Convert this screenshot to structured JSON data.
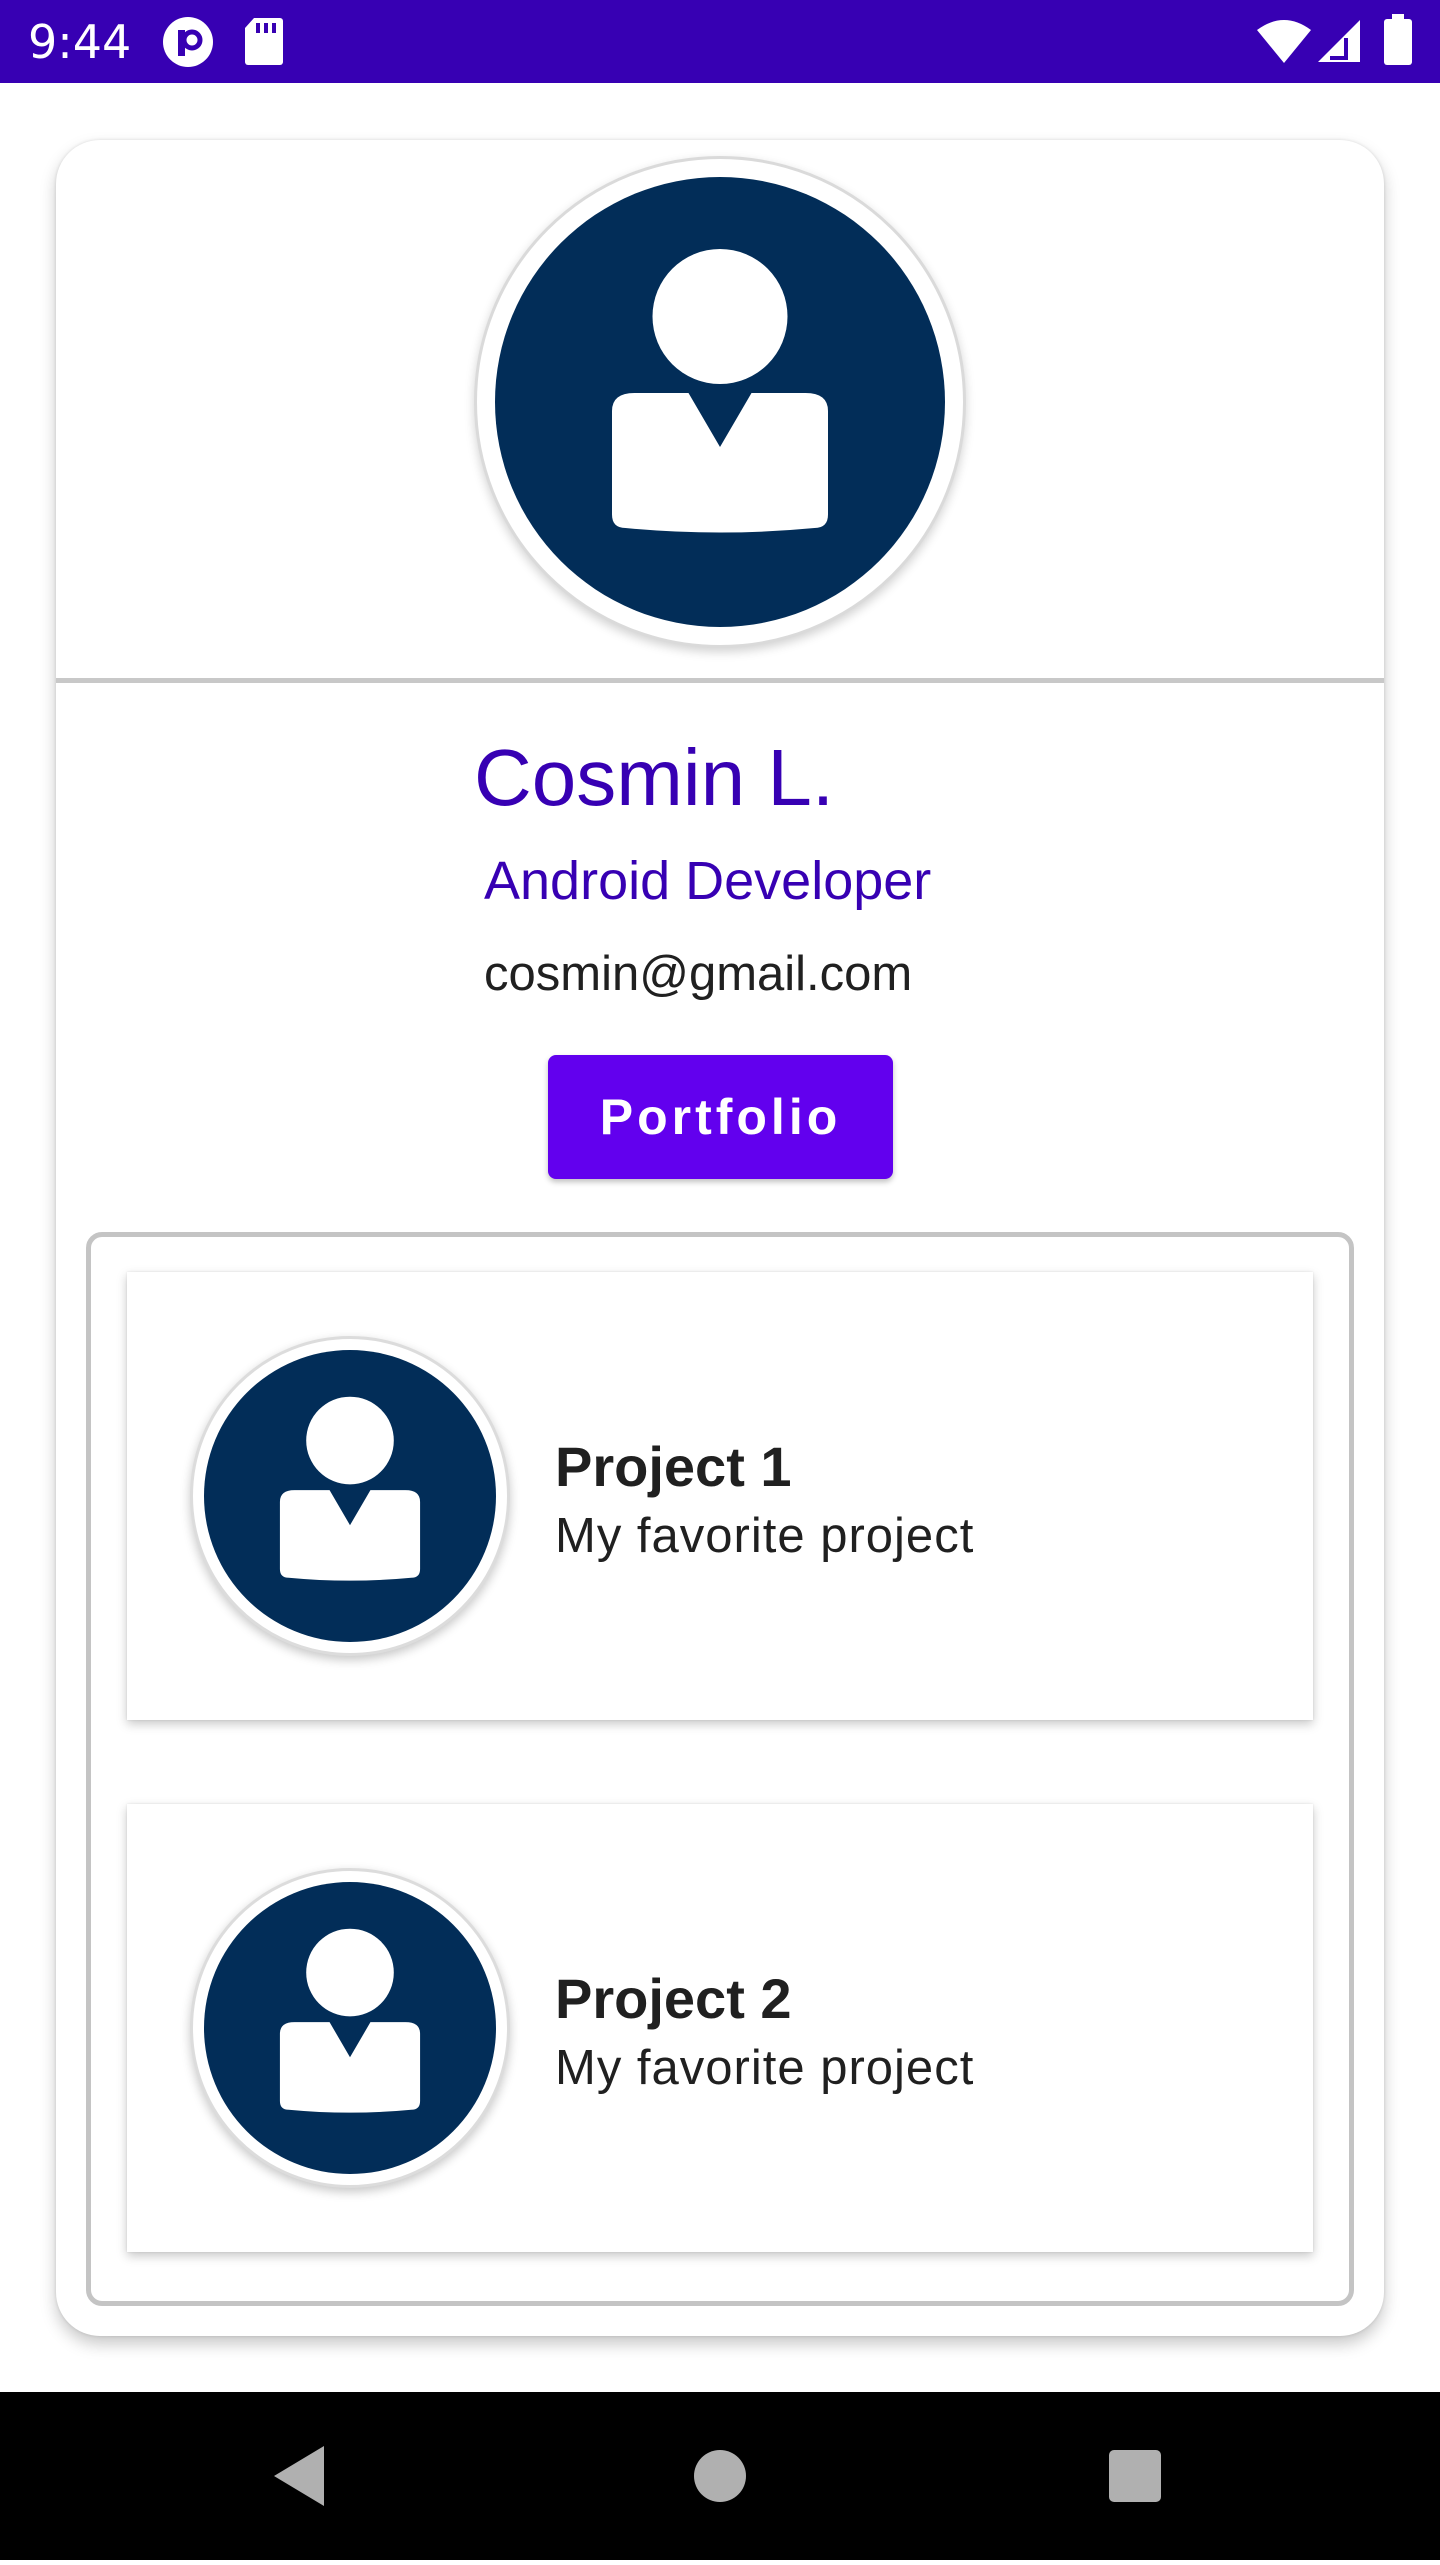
{
  "status_bar": {
    "time": "9:44",
    "icons": [
      "app-notification-icon",
      "sd-card-icon",
      "wifi-icon",
      "cell-signal-icon",
      "battery-icon"
    ]
  },
  "profile": {
    "photo_icon": "person-avatar-icon",
    "name": "Cosmin L.",
    "role": "Android Developer",
    "email": "cosmin@gmail.com",
    "portfolio_button_label": "Portfolio"
  },
  "projects": [
    {
      "title": "Project 1",
      "description": "My favorite project",
      "icon": "person-avatar-icon"
    },
    {
      "title": "Project 2",
      "description": "My favorite project",
      "icon": "person-avatar-icon"
    }
  ],
  "navigation": {
    "buttons": [
      "back-icon",
      "home-icon",
      "recents-icon"
    ]
  },
  "colors": {
    "status_bar": "#3700b3",
    "primary_text": "#3700b3",
    "button": "#6200ee",
    "avatar_background": "#022d58",
    "nav_bar": "#000000"
  }
}
